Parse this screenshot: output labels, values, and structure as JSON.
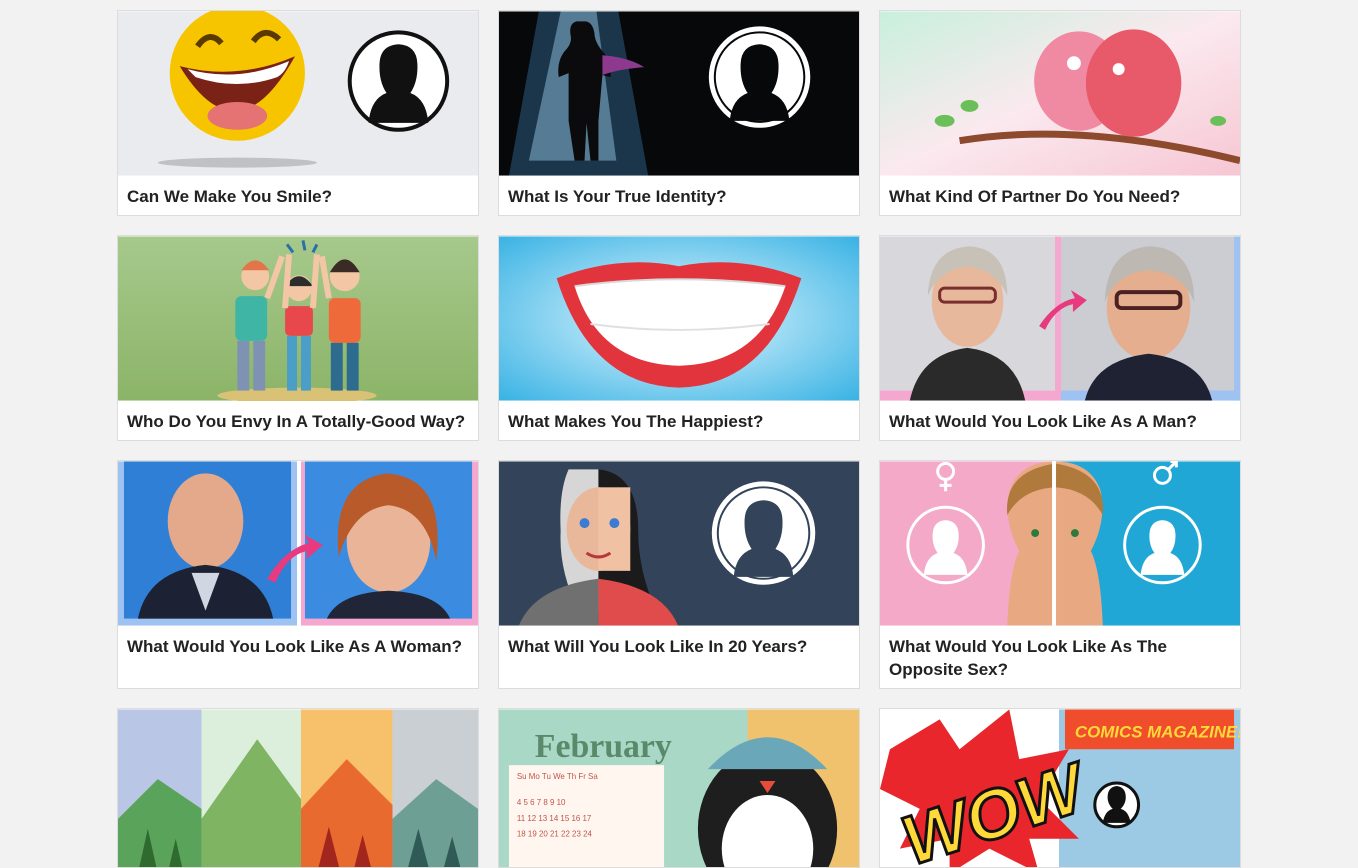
{
  "quizzes": [
    {
      "title": "Can We Make You Smile?"
    },
    {
      "title": "What Is Your True Identity?"
    },
    {
      "title": "What Kind Of Partner Do You Need?"
    },
    {
      "title": "Who Do You Envy In A Totally-Good Way?"
    },
    {
      "title": "What Makes You The Happiest?"
    },
    {
      "title": "What Would You Look Like As A Man?"
    },
    {
      "title": "What Would You Look Like As A Woman?"
    },
    {
      "title": "What Will You Look Like In 20 Years?"
    },
    {
      "title": "What Would You Look Like As The Opposite Sex?"
    }
  ],
  "images": {
    "calendar_month": "February",
    "calendar_days": [
      "Su",
      "Mo",
      "Tu",
      "We",
      "Th",
      "Fr",
      "Sa"
    ],
    "comic_word": "WOW",
    "comic_magazine": "COMICS MAGAZINE!"
  },
  "colors": {
    "background": "#f2f2f2",
    "card": "#ffffff",
    "title_text": "#222222"
  }
}
